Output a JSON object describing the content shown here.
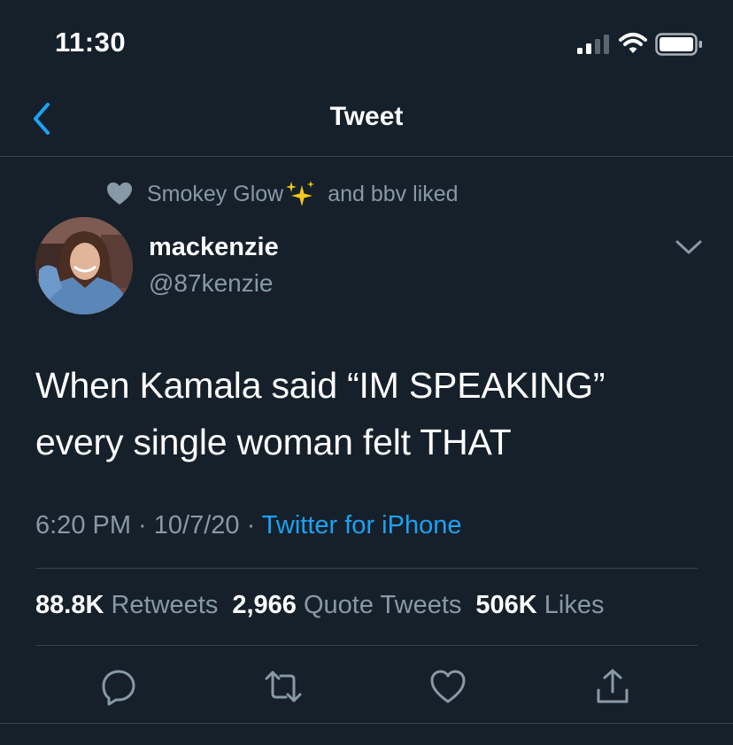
{
  "status_bar": {
    "time": "11:30"
  },
  "nav": {
    "title": "Tweet"
  },
  "social_context": {
    "text_before": "Smokey Glow",
    "text_after": "and bbv liked"
  },
  "author": {
    "display_name": "mackenzie",
    "handle": "@87kenzie"
  },
  "tweet": {
    "text": "When Kamala said “IM SPEAKING”\nevery single woman felt THAT"
  },
  "meta": {
    "time": "6:20 PM",
    "separator": " · ",
    "date": "10/7/20",
    "source": "Twitter for iPhone"
  },
  "stats": {
    "retweets_count": "88.8K",
    "retweets_label": "Retweets",
    "quote_count": "2,966",
    "quote_label": "Quote Tweets",
    "likes_count": "506K",
    "likes_label": "Likes"
  },
  "colors": {
    "background": "#15202b",
    "accent": "#1da1f2",
    "secondary_text": "#8899a6",
    "divider": "#38444d"
  },
  "icons": [
    "signal-icon",
    "wifi-icon",
    "battery-icon",
    "back-icon",
    "heart-icon",
    "sparkles-icon",
    "chevron-down-icon",
    "reply-icon",
    "retweet-icon",
    "like-icon",
    "share-icon"
  ]
}
